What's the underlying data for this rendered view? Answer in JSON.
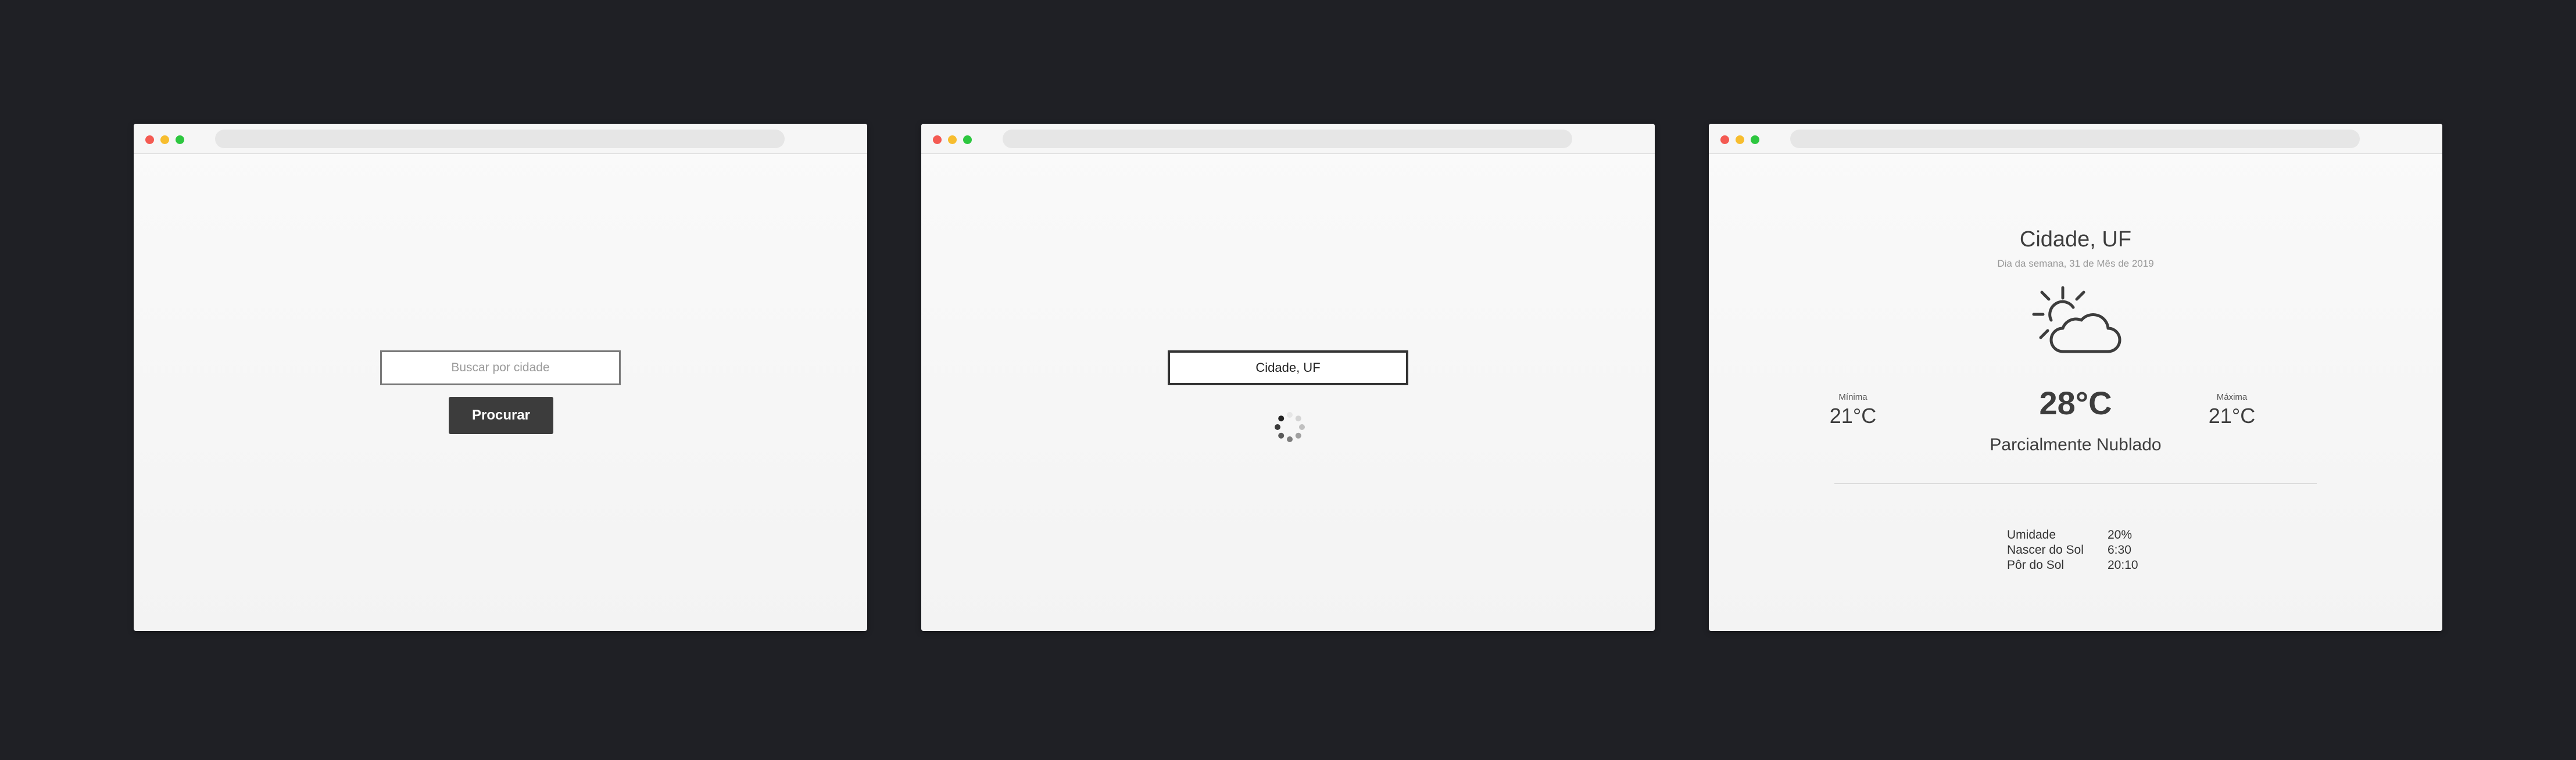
{
  "window_colors": {
    "close": "#f45a52",
    "minimize": "#f7bd2e",
    "maximize": "#2dc73f",
    "accent_button": "#3c3c3c",
    "page_background": "#1f2025"
  },
  "search_screen": {
    "search_placeholder": "Buscar por cidade",
    "search_button_label": "Procurar"
  },
  "loading_screen": {
    "search_value": "Cidade, UF",
    "spinner_icon": "loading-spinner-icon"
  },
  "result_screen": {
    "city": "Cidade, UF",
    "date": "Dia da semana, 31 de Mês de 2019",
    "icon": "partly-cloudy-icon",
    "min_label": "Mínima",
    "min_value": "21°C",
    "max_label": "Máxima",
    "max_value": "21°C",
    "temperature": "28°C",
    "condition": "Parcialmente Nublado",
    "details": [
      {
        "label": "Umidade",
        "value": "20%"
      },
      {
        "label": "Nascer do Sol",
        "value": "6:30"
      },
      {
        "label": "Pôr do Sol",
        "value": "20:10"
      }
    ]
  }
}
